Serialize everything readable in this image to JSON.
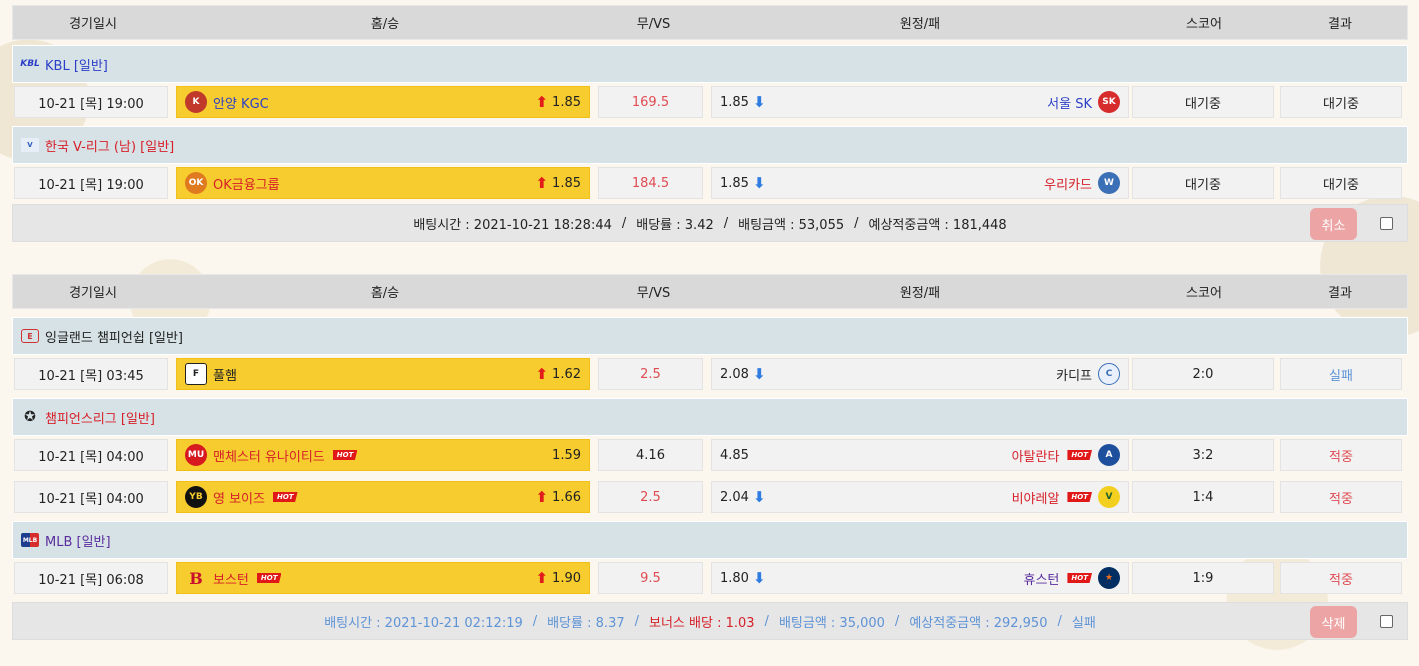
{
  "header": {
    "date": "경기일시",
    "home": "홈/승",
    "draw": "무/VS",
    "away": "원정/패",
    "score": "스코어",
    "result": "결과"
  },
  "bet1": {
    "leagues": [
      {
        "icon": "kbl-logo-icon",
        "name": "KBL [일반]",
        "color": "#2c3fc7",
        "match": {
          "date": "10-21 [목] 19:00",
          "home": "안양 KGC",
          "home_odds": "1.85",
          "draw": "169.5",
          "away": "서울 SK",
          "away_odds": "1.85",
          "score": "대기중",
          "result": "대기중"
        }
      },
      {
        "icon": "v-league-logo-icon",
        "name": "한국 V-리그 (남) [일반]",
        "color": "#d6202a",
        "match": {
          "date": "10-21 [목] 19:00",
          "home": "OK금융그룹",
          "home_odds": "1.85",
          "draw": "184.5",
          "away": "우리카드",
          "away_odds": "1.85",
          "score": "대기중",
          "result": "대기중"
        }
      }
    ],
    "summary": {
      "time": "배팅시간 : 2021-10-21 18:28:44",
      "rate": "배당률 : 3.42",
      "amount": "배팅금액 : 53,055",
      "expected": "예상적중금액 : 181,448",
      "button": "취소"
    }
  },
  "bet2": {
    "leagues": [
      {
        "icon": "championship-logo-icon",
        "name": "잉글랜드 챔피언쉽 [일반]",
        "color": "#222222"
      },
      {
        "icon": "champions-league-logo-icon",
        "name": "챔피언스리그 [일반]",
        "color": "#d6202a"
      },
      {
        "icon": "mlb-logo-icon",
        "name": "MLB [일반]",
        "color": "#5a2e9e"
      }
    ],
    "matches": [
      {
        "date": "10-21 [목] 03:45",
        "home": "풀햄",
        "home_odds": "1.62",
        "draw": "2.5",
        "away": "카디프",
        "away_odds": "2.08",
        "score": "2:0",
        "result": "실패"
      },
      {
        "date": "10-21 [목] 04:00",
        "home": "맨체스터 유나이티드",
        "home_odds": "1.59",
        "draw": "4.16",
        "away": "아탈란타",
        "away_odds": "4.85",
        "score": "3:2",
        "result": "적중"
      },
      {
        "date": "10-21 [목] 04:00",
        "home": "영 보이즈",
        "home_odds": "1.66",
        "draw": "2.5",
        "away": "비야레알",
        "away_odds": "2.04",
        "score": "1:4",
        "result": "적중"
      },
      {
        "date": "10-21 [목] 06:08",
        "home": "보스턴",
        "home_odds": "1.90",
        "draw": "9.5",
        "away": "휴스턴",
        "away_odds": "1.80",
        "score": "1:9",
        "result": "적중"
      }
    ],
    "hot_label": "HOT",
    "summary": {
      "time": "배팅시간 : 2021-10-21 02:12:19",
      "rate": "배당률 : 8.37",
      "bonus": "보너스 배당 : 1.03",
      "amount": "배팅금액 : 35,000",
      "expected": "예상적중금액 : 292,950",
      "status": "실패",
      "button": "삭제"
    }
  }
}
